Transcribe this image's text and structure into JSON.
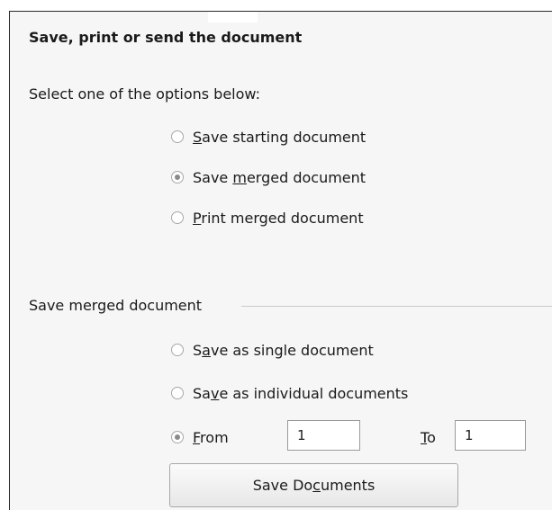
{
  "heading": "Save, print or send the document",
  "instruction": "Select one of the options below:",
  "options": [
    {
      "pre": "",
      "mn": "S",
      "post": "ave starting document",
      "checked": false
    },
    {
      "pre": "Save ",
      "mn": "m",
      "post": "erged document",
      "checked": true
    },
    {
      "pre": "",
      "mn": "P",
      "post": "rint merged document",
      "checked": false
    }
  ],
  "section": {
    "title": "Save merged document",
    "single": {
      "pre": "S",
      "mn": "a",
      "post": "ve as single document",
      "checked": false
    },
    "individual": {
      "pre": "Sa",
      "mn": "v",
      "post": "e as individual documents",
      "checked": false
    },
    "from": {
      "pre": "",
      "mn": "F",
      "post": "rom",
      "checked": true,
      "value": "1"
    },
    "to": {
      "mn": "T",
      "post": "o",
      "value": "1"
    },
    "button": {
      "pre": "Save Do",
      "mn": "c",
      "post": "uments"
    }
  }
}
